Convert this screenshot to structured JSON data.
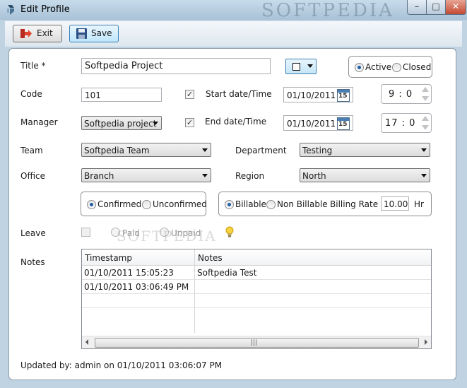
{
  "window": {
    "title": "Edit Profile",
    "watermark": "SOFTPEDIA",
    "min_glyph": "–",
    "max_glyph": "□",
    "close_glyph": "✕"
  },
  "toolbar": {
    "exit_label": "Exit",
    "save_label": "Save"
  },
  "form": {
    "title_label": "Title *",
    "title_value": "Softpedia Project",
    "status": {
      "active_label": "Active",
      "closed_label": "Closed",
      "selected": "Active"
    },
    "code_label": "Code",
    "code_value": "101",
    "start_label": "Start date/Time",
    "start_checked": true,
    "start_date": "01/10/2011",
    "start_time": "9 : 0",
    "manager_label": "Manager",
    "manager_value": "Softpedia project",
    "end_label": "End date/Time",
    "end_checked": true,
    "end_date": "01/10/2011",
    "end_time": "17 : 0",
    "calendar_day": "15",
    "team_label": "Team",
    "team_value": "Softpedia Team",
    "department_label": "Department",
    "department_value": "Testing",
    "office_label": "Office",
    "office_value": "Branch",
    "region_label": "Region",
    "region_value": "North",
    "confirm": {
      "confirmed_label": "Confirmed",
      "unconfirmed_label": "Unconfirmed",
      "selected": "Confirmed"
    },
    "billing": {
      "billable_label": "Billable",
      "non_billable_label": "Non Billable",
      "selected": "Billable",
      "rate_label": "Billing Rate",
      "rate_value": "10.00",
      "rate_unit": "Hr"
    },
    "leave_label": "Leave",
    "leave_paid_label": "Paid",
    "leave_unpaid_label": "Unpaid",
    "notes_label": "Notes"
  },
  "notes_grid": {
    "columns": [
      "Timestamp",
      "Notes"
    ],
    "rows": [
      [
        "01/10/2011 15:05:23",
        "Softpedia Test"
      ],
      [
        "01/10/2011 03:06:49 PM",
        ""
      ],
      [
        "",
        ""
      ]
    ],
    "watermark": "SOFTPEDIA",
    "scroll_grip": "|||"
  },
  "footer": {
    "updated_text": "Updated by: admin on 01/10/2011 03:06:07 PM"
  },
  "colors": {
    "accent": "#1f5ea8",
    "window_frame": "#bfd3e3"
  },
  "icons": [
    "app-logo-icon",
    "exit-icon",
    "save-icon",
    "calendar-icon",
    "lightbulb-icon"
  ]
}
